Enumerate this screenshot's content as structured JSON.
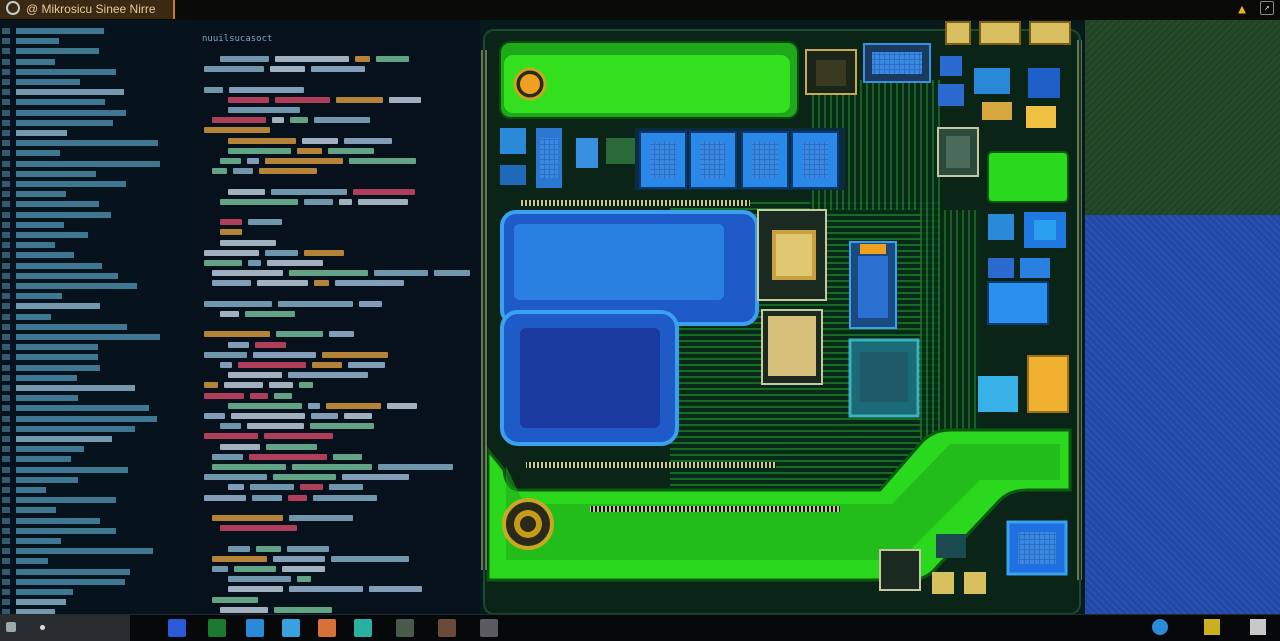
{
  "window": {
    "title": "@ Mikrosicu Sinee Nirre",
    "title_tab_color": "#3a2a14",
    "accent": "#c8801a",
    "right_icons": [
      "alert-icon",
      "share-icon"
    ]
  },
  "editor": {
    "header": "nuuilsucasoct"
  },
  "colors": {
    "pcb_green": "#2bd81e",
    "pcb_blue": "#2a78e8",
    "chip_gold": "#d8b860",
    "trace": "#1f6a2a",
    "panel_blue": "#1f48a8",
    "panel_green": "#244a2a"
  },
  "taskbar": {
    "icons": [
      "search-icon",
      "chip-app-icon",
      "terminal-icon",
      "browser-icon",
      "files-icon",
      "notes-icon",
      "code-icon",
      "photo-icon",
      "settings-icon",
      "image-icon"
    ],
    "tray_icons": [
      "network-icon",
      "display-icon",
      "clock-icon"
    ]
  }
}
